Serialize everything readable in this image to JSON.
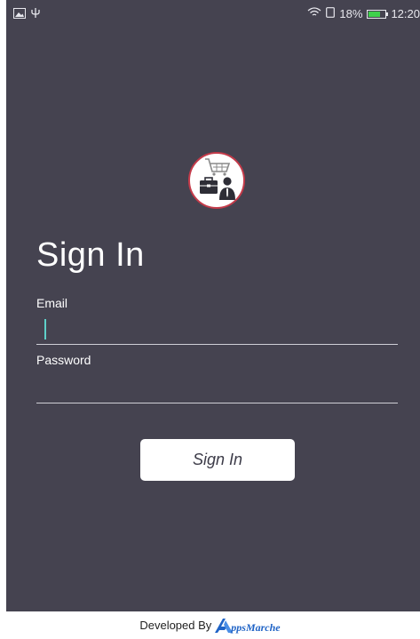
{
  "status_bar": {
    "battery_percent": "18%",
    "time": "12:20",
    "battery_level": 0.18,
    "icons": [
      "image-icon",
      "usb-icon",
      "wifi-icon",
      "sim-icon",
      "battery-icon"
    ]
  },
  "app": {
    "logo_icon": "shopping-cart-briefcase-person-icon",
    "title": "Sign In",
    "email": {
      "label": "Email",
      "value": ""
    },
    "password": {
      "label": "Password",
      "value": ""
    },
    "sign_in_button": "Sign In"
  },
  "footer": {
    "developed_by": "Developed By",
    "brand_text": "ppsMarche",
    "brand_icon": "appsmarche-a-logo-icon"
  },
  "colors": {
    "background": "#454350",
    "accent_caret": "#5fd0c9",
    "logo_ring": "#c43b4a",
    "brand_blue": "#1f63c6"
  }
}
